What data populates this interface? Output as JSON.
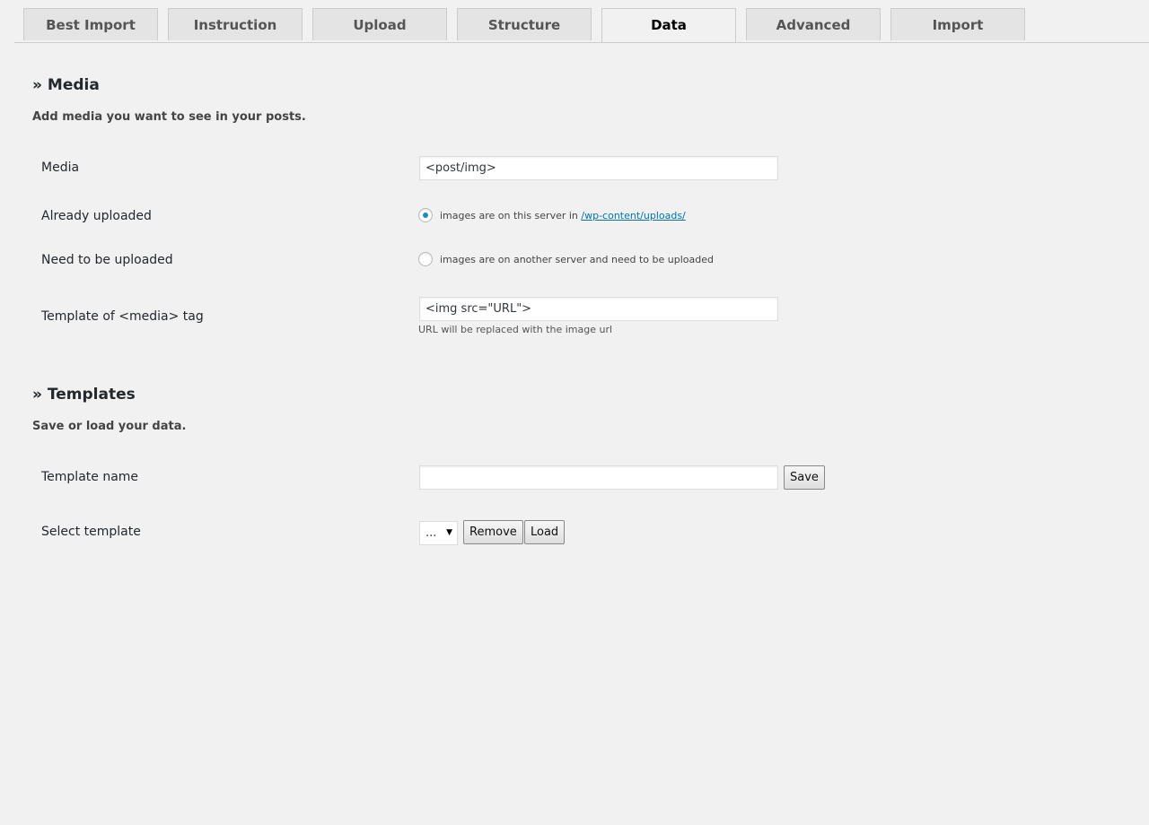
{
  "tabs": [
    {
      "label": "Best Import"
    },
    {
      "label": "Instruction"
    },
    {
      "label": "Upload"
    },
    {
      "label": "Structure"
    },
    {
      "label": "Data",
      "active": true
    },
    {
      "label": "Advanced"
    },
    {
      "label": "Import"
    }
  ],
  "media": {
    "title": "» Media",
    "description": "Add media you want to see in your posts.",
    "media_label": "Media",
    "media_value": "<post/img>",
    "already_uploaded_label": "Already uploaded",
    "already_uploaded_text": "images are on this server in",
    "already_uploaded_link": "/wp-content/uploads/",
    "need_upload_label": "Need to be uploaded",
    "need_upload_text": "images are on another server and need to be uploaded",
    "template_label": "Template of <media> tag",
    "template_value": "<img src=\"URL\">",
    "template_hint": "URL will be replaced with the image url"
  },
  "templates": {
    "title": "» Templates",
    "description": "Save or load your data.",
    "name_label": "Template name",
    "name_value": "",
    "save_button": "Save",
    "select_label": "Select template",
    "select_value": "...",
    "remove_button": "Remove",
    "load_button": "Load"
  }
}
